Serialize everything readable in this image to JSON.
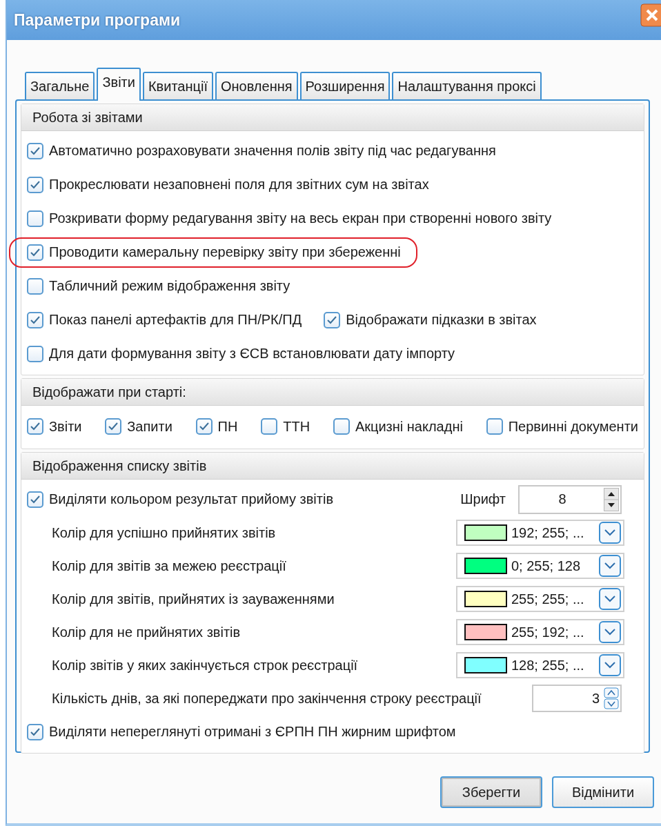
{
  "window": {
    "title": "Параметри програми"
  },
  "tabs": [
    {
      "label": "Загальне",
      "selected": false
    },
    {
      "label": "Звіти",
      "selected": true
    },
    {
      "label": "Квитанції",
      "selected": false
    },
    {
      "label": "Оновлення",
      "selected": false
    },
    {
      "label": "Розширення",
      "selected": false
    },
    {
      "label": "Налаштування проксі",
      "selected": false
    }
  ],
  "sections": [
    {
      "title": "Робота зі звітами",
      "items": [
        {
          "kind": "checks",
          "options": [
            {
              "label": "Автоматично розраховувати значення полів звіту під час редагування",
              "checked": true
            }
          ]
        },
        {
          "kind": "checks",
          "options": [
            {
              "label": "Прокреслювати незаповнені поля для звітних сум на звітах",
              "checked": true
            }
          ]
        },
        {
          "kind": "checks",
          "options": [
            {
              "label": "Розкривати форму редагування звіту на весь екран при створенні нового звіту",
              "checked": false
            }
          ]
        },
        {
          "kind": "checks",
          "annotated": true,
          "options": [
            {
              "label": "Проводити камеральну перевірку звіту при збереженні",
              "checked": true
            }
          ]
        },
        {
          "kind": "checks",
          "options": [
            {
              "label": "Табличний режим відображення звіту",
              "checked": false
            }
          ]
        },
        {
          "kind": "checks",
          "options": [
            {
              "label": "Показ панелі артефактів для ПН/РК/ПД",
              "checked": true
            },
            {
              "label": "Відображати підказки в звітах",
              "checked": true
            }
          ]
        },
        {
          "kind": "checks",
          "options": [
            {
              "label": "Для дати формування звіту з ЄСВ встановлювати дату імпорту",
              "checked": false
            }
          ]
        }
      ]
    },
    {
      "title": "Відображати при старті:",
      "items": [
        {
          "kind": "checks",
          "spread": true,
          "options": [
            {
              "label": "Звіти",
              "checked": true
            },
            {
              "label": "Запити",
              "checked": true
            },
            {
              "label": "ПН",
              "checked": true
            },
            {
              "label": "ТТН",
              "checked": false
            },
            {
              "label": "Акцизні накладні",
              "checked": false
            },
            {
              "label": "Первинні документи",
              "checked": false
            }
          ]
        }
      ]
    },
    {
      "title": "Відображення списку звітів",
      "items": [
        {
          "kind": "check_spin",
          "option": {
            "label": "Виділяти кольором результат прийому звітів",
            "checked": true
          },
          "spin_label": "Шрифт",
          "value": "8"
        },
        {
          "kind": "color",
          "label": "Колір для успішно прийнятих звітів",
          "value": "192; 255; ...",
          "color": "#c0ffc0"
        },
        {
          "kind": "color",
          "label": "Колір для звітів за межею реєстрації",
          "value": "0; 255; 128",
          "color": "#00ff80"
        },
        {
          "kind": "color",
          "label": "Колір для звітів, прийнятих із зауваженнями",
          "value": "255; 255; ...",
          "color": "#ffffc0"
        },
        {
          "kind": "color",
          "label": "Колір для не прийнятих звітів",
          "value": "255; 192; ...",
          "color": "#ffc0c0"
        },
        {
          "kind": "color",
          "label": "Колір звітів у яких закінчується строк реєстрації",
          "value": "128; 255; ...",
          "color": "#80ffff"
        },
        {
          "kind": "spin",
          "label": "Кількість днів, за які попереджати про закінчення строку реєстрації",
          "value": "3"
        },
        {
          "kind": "checks",
          "options": [
            {
              "label": "Виділяти непереглянуті отримані з ЄРПН ПН жирним шрифтом",
              "checked": true
            }
          ]
        }
      ]
    }
  ],
  "buttons": [
    {
      "label": "Зберегти",
      "focused": true
    },
    {
      "label": "Відмінити",
      "focused": false
    }
  ]
}
